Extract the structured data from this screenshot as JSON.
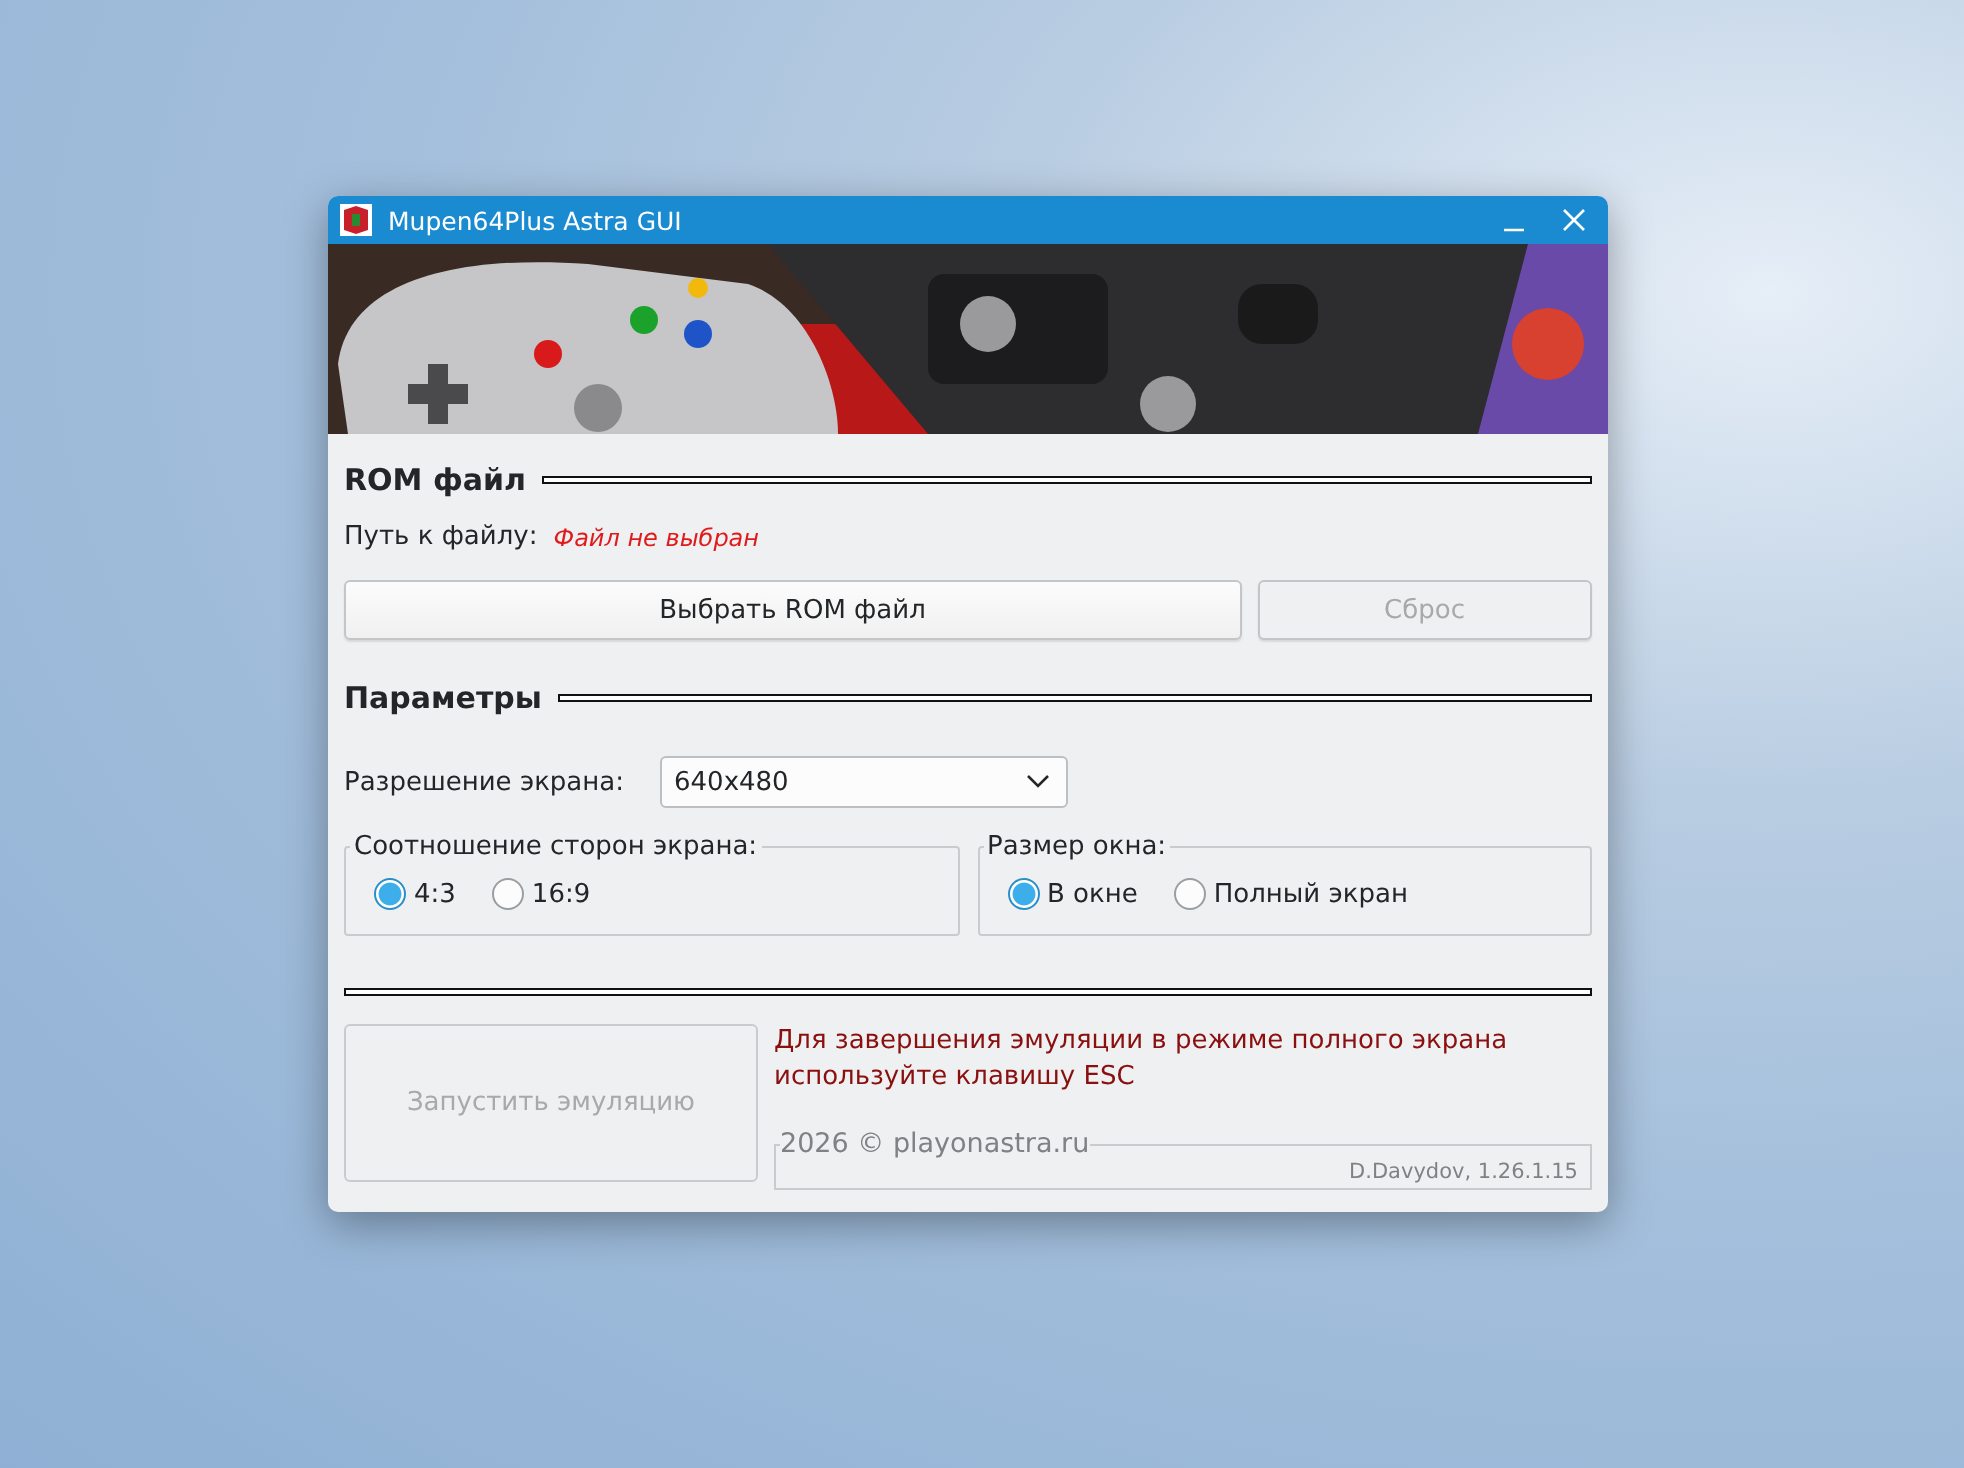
{
  "window": {
    "title": "Mupen64Plus Astra GUI"
  },
  "rom_section": {
    "title": "ROM файл",
    "path_label": "Путь к файлу:",
    "path_value": "Файл не выбран",
    "buttons": [
      {
        "label": "Выбрать ROM файл",
        "disabled": false
      },
      {
        "label": "Сброс",
        "disabled": true
      }
    ]
  },
  "params": {
    "title": "Параметры",
    "resolution_label": "Разрешение экрана:",
    "resolution_value": "640x480",
    "groups": [
      {
        "title": "Соотношение сторон экрана:",
        "options": [
          {
            "label": "4:3",
            "selected": true
          },
          {
            "label": "16:9",
            "selected": false
          }
        ]
      },
      {
        "title": "Размер окна:",
        "options": [
          {
            "label": "В окне",
            "selected": true
          },
          {
            "label": "Полный экран",
            "selected": false
          }
        ]
      }
    ]
  },
  "launch": {
    "label": "Запустить эмуляцию",
    "disabled": true
  },
  "notice": "Для завершения эмуляции в режиме полного экрана используйте клавишу ESC",
  "footer": {
    "title": "2026 © playonastra.ru",
    "version": "D.Davydov, 1.26.1.15"
  }
}
